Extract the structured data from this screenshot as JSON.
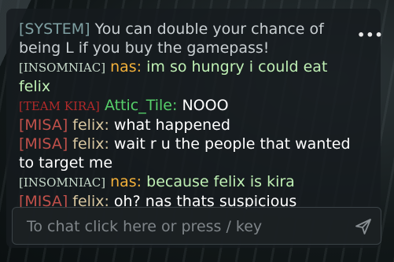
{
  "chat": {
    "menu_glyph": "•••",
    "messages": [
      {
        "tag": "[SYSTEM]",
        "text": "You can double your chance of being L if you buy the gamepass!"
      },
      {
        "tag": "[INSOMNIAC]",
        "name": "nas:",
        "text": "im so hungry i could eat felix"
      },
      {
        "tag": "[TEAM KIRA]",
        "name": "Attic_Tile:",
        "text": "NOOO"
      },
      {
        "tag": "[MISA]",
        "name": "felix:",
        "text": "what happened"
      },
      {
        "tag": "[MISA]",
        "name": "felix:",
        "text": "wait r u the people that wanted to target me"
      },
      {
        "tag": "[INSOMNIAC]",
        "name": "nas:",
        "text": "because felix is kira"
      },
      {
        "tag": "[MISA]",
        "name": "felix:",
        "text": "oh? nas thats suspicious"
      }
    ],
    "input": {
      "placeholder": "To chat click here or press / key"
    },
    "send_icon": "send-icon"
  }
}
